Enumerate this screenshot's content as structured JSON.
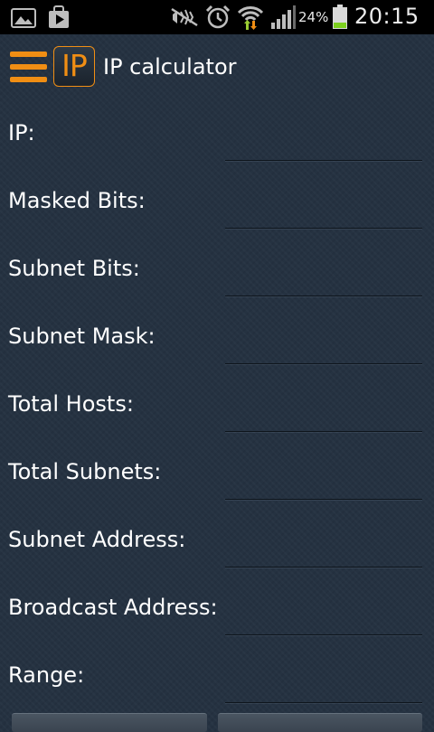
{
  "status_bar": {
    "battery_percent": "24%",
    "time": "20:15",
    "icons": [
      "gallery-icon",
      "play-store-icon",
      "mute-icon",
      "alarm-icon",
      "wifi-icon",
      "signal-icon",
      "battery-icon"
    ]
  },
  "app_bar": {
    "logo_text": "IP",
    "title": "IP calculator",
    "accent_color": "#f08e14"
  },
  "form": {
    "fields": [
      {
        "label": "IP:",
        "value": ""
      },
      {
        "label": "Masked Bits:",
        "value": ""
      },
      {
        "label": "Subnet Bits:",
        "value": ""
      },
      {
        "label": "Subnet Mask:",
        "value": ""
      },
      {
        "label": "Total Hosts:",
        "value": ""
      },
      {
        "label": "Total Subnets:",
        "value": ""
      },
      {
        "label": "Subnet Address:",
        "value": ""
      },
      {
        "label": "Broadcast Address:",
        "value": ""
      },
      {
        "label": "Range:",
        "value": ""
      }
    ]
  },
  "colors": {
    "background": "#253241",
    "status_bar": "#000000",
    "text": "#ffffff",
    "battery_level": "#7ccf1e"
  }
}
